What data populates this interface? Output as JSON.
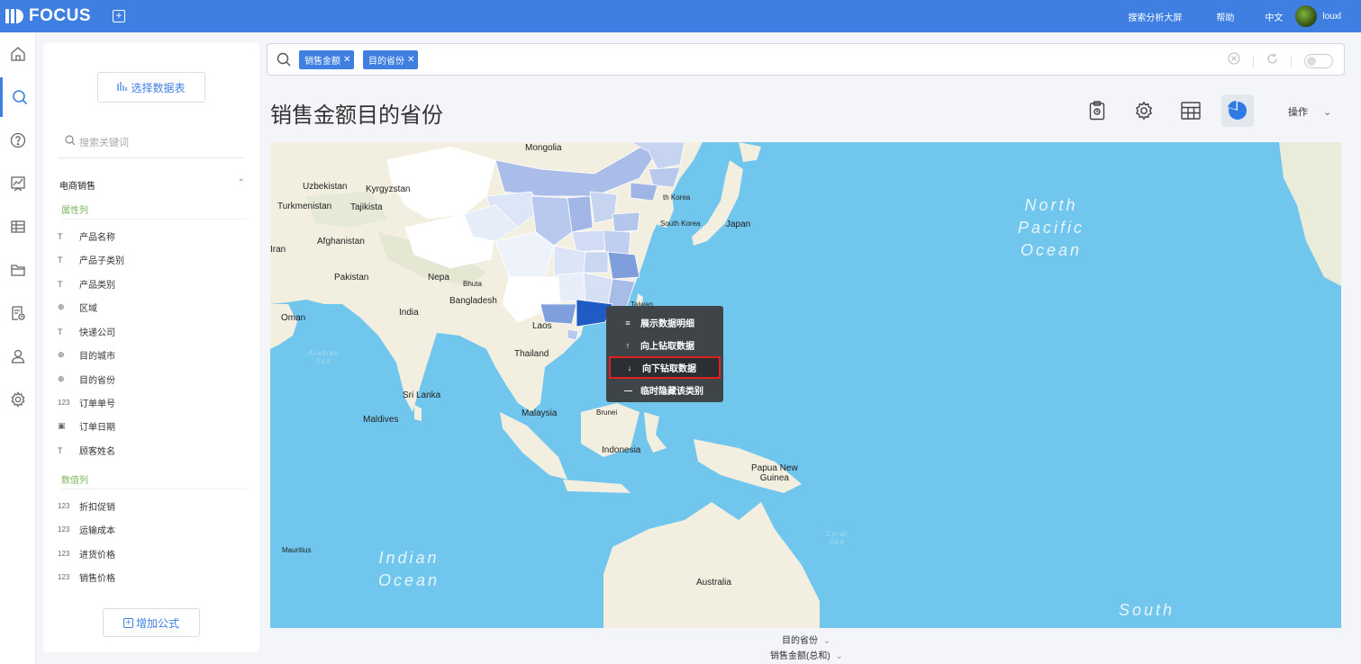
{
  "topbar": {
    "brand": "FOCUS",
    "links": [
      "搜索分析大屏",
      "帮助",
      "中文"
    ],
    "username": "louxl"
  },
  "rail": {
    "icons": [
      "home-icon",
      "search-icon",
      "help-icon",
      "chart-icon",
      "table-icon",
      "folder-icon",
      "report-icon",
      "user-icon",
      "settings-icon"
    ],
    "active": "search-icon"
  },
  "sidebar": {
    "select_table_label": "选择数据表",
    "search_placeholder": "搜索关键词",
    "group": "电商销售",
    "attr_section": "属性列",
    "attr_fields": [
      {
        "icon": "T",
        "label": "产品名称"
      },
      {
        "icon": "T",
        "label": "产品子类别"
      },
      {
        "icon": "T",
        "label": "产品类别"
      },
      {
        "icon": "globe",
        "label": "区域"
      },
      {
        "icon": "T",
        "label": "快递公司"
      },
      {
        "icon": "globe",
        "label": "目的城市"
      },
      {
        "icon": "globe",
        "label": "目的省份"
      },
      {
        "icon": "123",
        "label": "订单单号"
      },
      {
        "icon": "calendar",
        "label": "订单日期"
      },
      {
        "icon": "T",
        "label": "顾客姓名"
      }
    ],
    "num_section": "数值列",
    "num_fields": [
      {
        "icon": "123",
        "label": "折扣促销"
      },
      {
        "icon": "123",
        "label": "运输成本"
      },
      {
        "icon": "123",
        "label": "进货价格"
      },
      {
        "icon": "123",
        "label": "销售价格"
      }
    ],
    "add_formula_label": "增加公式"
  },
  "search": {
    "tokens": [
      "销售金额",
      "目的省份"
    ]
  },
  "main": {
    "title": "销售金额目的省份",
    "ops_label": "操作",
    "tools": [
      "clipboard-icon",
      "settings-icon",
      "table-view-icon",
      "pie-chart-icon"
    ],
    "active_tool": "pie-chart-icon"
  },
  "map": {
    "labels": {
      "mongolia": "Mongolia",
      "uzbekistan": "Uzbekistan",
      "kyrgyzstan": "Kyrgyzstan",
      "turkmenistan": "Turkmenistan",
      "tajikistan": "Tajikista",
      "afghanistan": "Afghanistan",
      "iran": "Iran",
      "pakistan": "Pakistan",
      "nepal": "Nepa",
      "bhutan": "Bhuta",
      "india": "India",
      "bangladesh": "Bangladesh",
      "oman": "Oman",
      "laos": "Laos",
      "thailand": "Thailand",
      "sri_lanka": "Sri Lanka",
      "maldives": "Maldives",
      "malaysia": "Malaysia",
      "brunei": "Brunei",
      "indonesia": "Indonesia",
      "png": "Papua New\nGuinea",
      "australia": "Australia",
      "mauritius": "Mauritius",
      "north_korea": "th Korea",
      "south_korea": "South Korea",
      "japan": "Japan",
      "taiwan": "Taiwan",
      "north_pacific": "North\nPacific\nOcean",
      "south_pacific": "South",
      "indian_ocean": "Indian\nOcean",
      "arabian_sea": "Arabian\nSea",
      "coral_sea": "Coral\nSea"
    }
  },
  "context_menu": {
    "items": [
      {
        "icon": "database-icon",
        "glyph": "≡",
        "label": "展示数据明细"
      },
      {
        "icon": "arrow-up-icon",
        "glyph": "↑",
        "label": "向上钻取数据"
      },
      {
        "icon": "arrow-down-icon",
        "glyph": "↓",
        "label": "向下钻取数据"
      },
      {
        "icon": "minus-icon",
        "glyph": "—",
        "label": "临时隐藏该类别"
      }
    ],
    "highlighted_index": 2,
    "highlight_color": "#e02020"
  },
  "axes": {
    "x_label": "目的省份",
    "y_label": "销售金额(总和)"
  },
  "colors": {
    "brand": "#3e7fe1",
    "attr_section": "#7ab55c",
    "ocean": "#70c6ec",
    "land": "#f2efe0",
    "choropleth_dark": "#1f5bc4",
    "choropleth_light": "#dde6f7"
  }
}
